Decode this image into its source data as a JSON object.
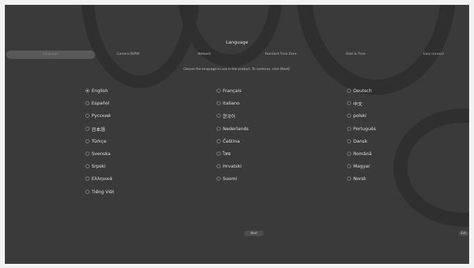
{
  "title": "Language",
  "steps": [
    {
      "label": "Language",
      "active": true
    },
    {
      "label": "Camera ID/PW",
      "active": false
    },
    {
      "label": "Network",
      "active": false
    },
    {
      "label": "Standard Time Zone",
      "active": false
    },
    {
      "label": "Date & Time",
      "active": false
    },
    {
      "label": "Easy connect",
      "active": false
    }
  ],
  "instruction": "Choose the language to use in the product. To continue, click [Next].",
  "selected_language": "English",
  "languages": [
    {
      "label": "English"
    },
    {
      "label": "Français"
    },
    {
      "label": "Deutsch"
    },
    {
      "label": "Español"
    },
    {
      "label": "Italiano"
    },
    {
      "label": "中文"
    },
    {
      "label": "Русский"
    },
    {
      "label": "한국어"
    },
    {
      "label": "polski"
    },
    {
      "label": "日本語"
    },
    {
      "label": "Nederlands"
    },
    {
      "label": "Português"
    },
    {
      "label": "Türkçe"
    },
    {
      "label": "Čeština"
    },
    {
      "label": "Dansk"
    },
    {
      "label": "Svenska"
    },
    {
      "label": "ไทย"
    },
    {
      "label": "Română"
    },
    {
      "label": "Srpski"
    },
    {
      "label": "Hrvatski"
    },
    {
      "label": "Magyar"
    },
    {
      "label": "Ελληνικά"
    },
    {
      "label": "Suomi"
    },
    {
      "label": "Norsk"
    },
    {
      "label": "Tiếng Việt"
    }
  ],
  "buttons": {
    "next": "Next",
    "exit": "Exit"
  }
}
